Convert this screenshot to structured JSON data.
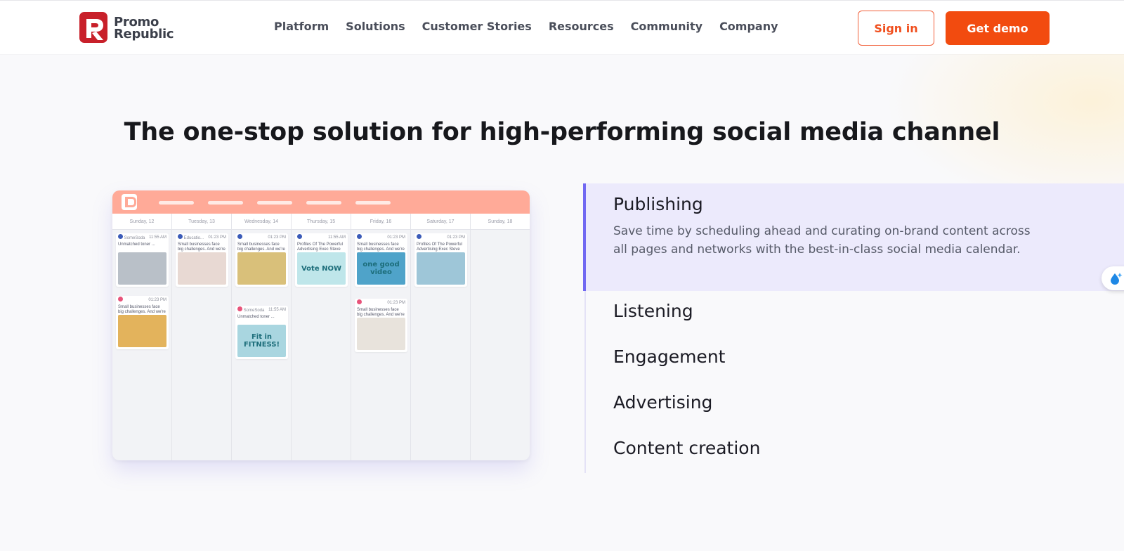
{
  "brand": {
    "line1": "Promo",
    "line2": "Republic",
    "accent": "#f24b0f",
    "logo_red": "#c8202a"
  },
  "nav": {
    "items": [
      "Platform",
      "Solutions",
      "Customer Stories",
      "Resources",
      "Community",
      "Company"
    ]
  },
  "header": {
    "signin_label": "Sign in",
    "demo_label": "Get demo"
  },
  "hero": {
    "title": "The one-stop solution for high-performing social media channel"
  },
  "mockup": {
    "days": [
      "Sunday, 12",
      "Tuesday, 13",
      "Wednesday, 14",
      "Thursday, 15",
      "Friday, 16",
      "Saturday, 17",
      "Sunday, 18"
    ],
    "cards": [
      {
        "col": 0,
        "time": "11:55 AM",
        "author": "SomeSoda",
        "text": "Unmatched toner ...",
        "img": "#b9c0c8"
      },
      {
        "col": 0,
        "time": "01:23 PM",
        "author": "",
        "text": "Small businesses face big challenges. And we're he...",
        "img": "#e3b35c"
      },
      {
        "col": 1,
        "time": "01:23 PM",
        "author": "Educatio...",
        "text": "Small businesses face big challenges. And we're he...",
        "img": "#e8d9d3"
      },
      {
        "col": 2,
        "time": "01:23 PM",
        "author": "",
        "text": "Small businesses face big challenges. And we're he...",
        "img": "#d9c07a"
      },
      {
        "col": 2,
        "time": "11:55 AM",
        "author": "SomeSoda",
        "text": "Unmatched toner ...",
        "img": "#a9d6e0",
        "img_text": "Fit in FITNESS!"
      },
      {
        "col": 3,
        "time": "11:55 AM",
        "author": "",
        "text": "Profiles Of The Powerful Advertising Exec Steve Grasse",
        "img": "#bfe6ea",
        "img_text": "Vote NOW"
      },
      {
        "col": 4,
        "time": "01:23 PM",
        "author": "",
        "text": "Small businesses face big challenges. And we're he...",
        "img": "#4fa3c9",
        "img_text": "one good video"
      },
      {
        "col": 4,
        "time": "01:23 PM",
        "author": "",
        "text": "Small businesses face big challenges. And we're he...",
        "img": "#e8e3dc"
      },
      {
        "col": 5,
        "time": "01:23 PM",
        "author": "",
        "text": "Profiles Of The Powerful Advertising Exec Steve Grasse",
        "img": "#9ec6d8"
      }
    ]
  },
  "features": {
    "active": {
      "title": "Publishing",
      "description": "Save time by scheduling ahead and curating on-brand content across all pages and networks with the best-in-class social media calendar."
    },
    "items": [
      "Listening",
      "Engagement",
      "Advertising",
      "Content creation"
    ],
    "active_color": "#7168f2"
  }
}
